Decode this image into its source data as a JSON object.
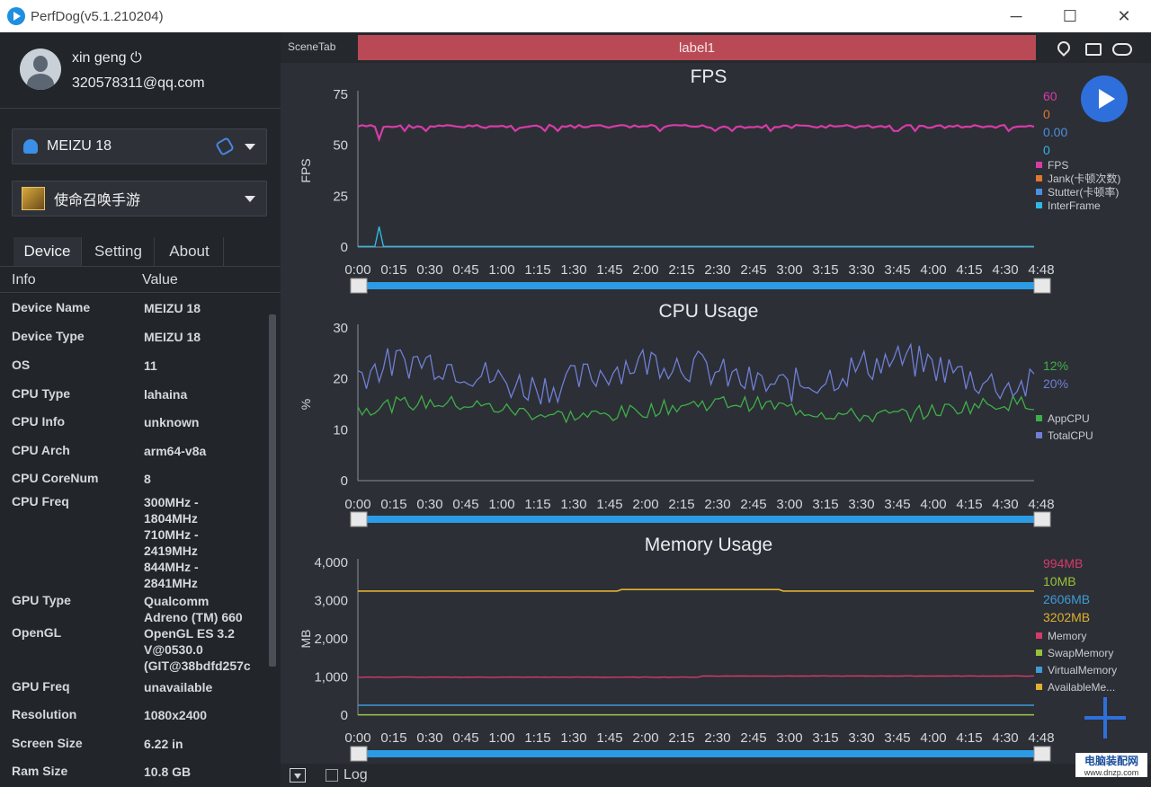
{
  "window": {
    "title": "PerfDog(v5.1.210204)",
    "minimize": "─",
    "maximize": "☐",
    "close": "✕"
  },
  "user": {
    "name": "xin geng ⏻",
    "email": "320578311@qq.com"
  },
  "device_select": {
    "label": "MEIZU 18"
  },
  "app_select": {
    "label": "使命召唤手游"
  },
  "tabs": [
    {
      "label": "Device"
    },
    {
      "label": "Setting"
    },
    {
      "label": "About"
    }
  ],
  "info_table": {
    "col_info": "Info",
    "col_value": "Value",
    "rows": [
      {
        "key": "Device Name",
        "value": "MEIZU 18"
      },
      {
        "key": "Device Type",
        "value": "MEIZU 18"
      },
      {
        "key": "OS",
        "value": "11"
      },
      {
        "key": "CPU Type",
        "value": "lahaina"
      },
      {
        "key": "CPU Info",
        "value": "unknown"
      },
      {
        "key": "CPU Arch",
        "value": "arm64-v8a"
      },
      {
        "key": "CPU CoreNum",
        "value": "8"
      },
      {
        "key": "CPU Freq",
        "value": "300MHz -\n1804MHz\n710MHz -\n2419MHz\n844MHz -\n2841MHz"
      },
      {
        "key": "GPU Type",
        "value": "Qualcomm\nAdreno (TM) 660"
      },
      {
        "key": "OpenGL",
        "value": "OpenGL ES 3.2\nV@0530.0\n(GIT@38bdfd257c"
      },
      {
        "key": "GPU Freq",
        "value": "unavailable"
      },
      {
        "key": "Resolution",
        "value": "1080x2400"
      },
      {
        "key": "Screen Size",
        "value": "6.22 in"
      },
      {
        "key": "Ram Size",
        "value": "10.8 GB"
      }
    ]
  },
  "scene": {
    "tab_label": "SceneTab",
    "label": "label1"
  },
  "bottom": {
    "log_label": "Log"
  },
  "watermark": {
    "line1": "电脑装配网",
    "line2": "www.dnzp.com"
  },
  "colors": {
    "fps": "#d63ca8",
    "jank": "#e0772f",
    "stutter": "#4a8fe0",
    "interframe": "#2fb8e6",
    "appcpu": "#3fae4a",
    "totalcpu": "#6f7fd6",
    "memory": "#d63a6a",
    "swap": "#98c23a",
    "virtual": "#3f9ad6",
    "available": "#e0b12f"
  },
  "chart_data": [
    {
      "type": "line",
      "title": "FPS",
      "ylabel": "FPS",
      "ylim": [
        0,
        75
      ],
      "yticks": [
        "75",
        "50",
        "25",
        "0"
      ],
      "xticks": [
        "0:00",
        "0:15",
        "0:30",
        "0:45",
        "1:00",
        "1:15",
        "1:30",
        "1:45",
        "2:00",
        "2:15",
        "2:30",
        "2:45",
        "3:00",
        "3:15",
        "3:30",
        "3:45",
        "4:00",
        "4:15",
        "4:30",
        "4:48"
      ],
      "legend_placement": "right",
      "series": [
        {
          "name": "FPS",
          "current": "60",
          "color": "#d63ca8"
        },
        {
          "name": "Jank(卡顿次数)",
          "current": "0",
          "color": "#e0772f"
        },
        {
          "name": "Stutter(卡顿率)",
          "current": "0.00",
          "color": "#4a8fe0"
        },
        {
          "name": "InterFrame",
          "current": "0",
          "color": "#2fb8e6"
        }
      ]
    },
    {
      "type": "line",
      "title": "CPU Usage",
      "ylabel": "%",
      "ylim": [
        0,
        30
      ],
      "yticks": [
        "30",
        "20",
        "10",
        "0"
      ],
      "xticks": [
        "0:00",
        "0:15",
        "0:30",
        "0:45",
        "1:00",
        "1:15",
        "1:30",
        "1:45",
        "2:00",
        "2:15",
        "2:30",
        "2:45",
        "3:00",
        "3:15",
        "3:30",
        "3:45",
        "4:00",
        "4:15",
        "4:30",
        "4:48"
      ],
      "legend_placement": "right",
      "series": [
        {
          "name": "AppCPU",
          "current": "12%",
          "color": "#3fae4a"
        },
        {
          "name": "TotalCPU",
          "current": "20%",
          "color": "#6f7fd6"
        }
      ]
    },
    {
      "type": "line",
      "title": "Memory Usage",
      "ylabel": "MB",
      "ylim": [
        0,
        4000
      ],
      "yticks": [
        "4,000",
        "3,000",
        "2,000",
        "1,000",
        "0"
      ],
      "xticks": [
        "0:00",
        "0:15",
        "0:30",
        "0:45",
        "1:00",
        "1:15",
        "1:30",
        "1:45",
        "2:00",
        "2:15",
        "2:30",
        "2:45",
        "3:00",
        "3:15",
        "3:30",
        "3:45",
        "4:00",
        "4:15",
        "4:30",
        "4:48"
      ],
      "legend_placement": "right",
      "series": [
        {
          "name": "Memory",
          "current": "994MB",
          "color": "#d63a6a"
        },
        {
          "name": "SwapMemory",
          "current": "10MB",
          "color": "#98c23a"
        },
        {
          "name": "VirtualMemory",
          "current": "2606MB",
          "color": "#3f9ad6"
        },
        {
          "name": "AvailableMe...",
          "current": "3202MB",
          "color": "#e0b12f"
        }
      ]
    }
  ]
}
